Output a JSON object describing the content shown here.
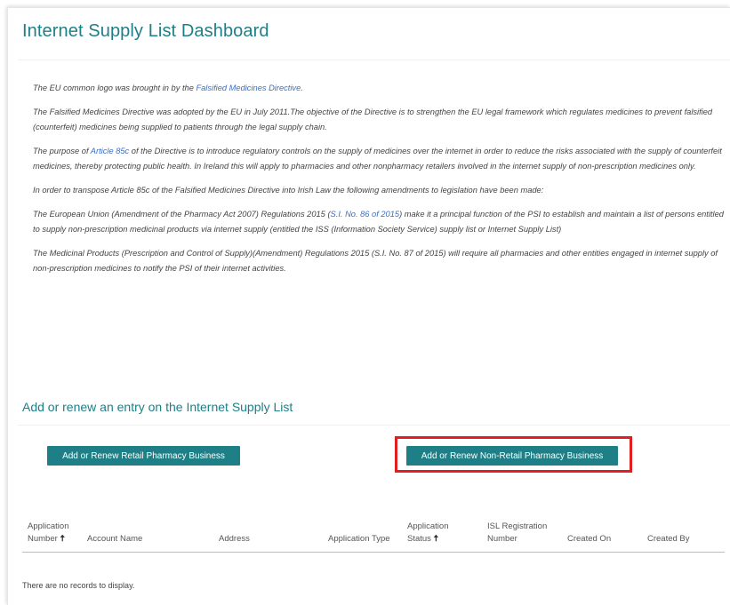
{
  "page": {
    "title": "Internet Supply List Dashboard"
  },
  "intro": {
    "p1_before": "The EU common logo was brought in by the ",
    "p1_link": "Falsified Medicines Directive",
    "p1_after": ".",
    "p2": "The Falsified Medicines Directive was adopted by the EU in July 2011.The objective of the Directive is to strengthen the EU legal framework which regulates medicines to prevent falsified (counterfeit) medicines being supplied to patients through the legal supply chain.",
    "p3_before": "The purpose of ",
    "p3_link": "Article 85c",
    "p3_after": " of the Directive is to introduce regulatory controls on the supply of medicines over the internet in order to reduce the risks associated with the supply of counterfeit medicines, thereby protecting public health. In Ireland this will apply to pharmacies and other nonpharmacy retailers involved in the internet supply of non-prescription medicines only.",
    "p4": "In order to transpose Article 85c of the Falsified Medicines Directive into Irish Law the following amendments to legislation have been made:",
    "p5_before": "The European Union (Amendment of the Pharmacy Act 2007) Regulations 2015 (",
    "p5_link": "S.I. No. 86 of 2015",
    "p5_after": ") make it a principal function of the PSI to establish and maintain a list of persons entitled to supply non-prescription medicinal products via internet supply (entitled the ISS (Information Society Service) supply list or Internet Supply List)",
    "p6": "The Medicinal Products (Prescription and Control of Supply)(Amendment) Regulations 2015 (S.I. No. 87 of 2015) will require all pharmacies and other entities engaged in internet supply of non-prescription medicines to notify the PSI of their internet activities."
  },
  "section": {
    "title": "Add or renew an entry on the Internet Supply List"
  },
  "buttons": {
    "retail": "Add or Renew Retail Pharmacy Business",
    "non_retail": "Add or Renew Non-Retail Pharmacy Business"
  },
  "table": {
    "headers": {
      "application_number_line1": "Application",
      "application_number_line2": "Number",
      "account_name": "Account Name",
      "address": "Address",
      "application_type": "Application Type",
      "application_status_line1": "Application",
      "application_status_line2": "Status",
      "isl_registration_line1": "ISL Registration",
      "isl_registration_line2": "Number",
      "created_on": "Created On",
      "created_by": "Created By"
    },
    "sort_arrow": "🠅",
    "empty_message": "There are no records to display."
  },
  "colors": {
    "accent": "#1e7f86",
    "link": "#3a6fc4",
    "highlight": "#e02020"
  },
  "icons": {
    "sort": "arrow-up-icon"
  }
}
